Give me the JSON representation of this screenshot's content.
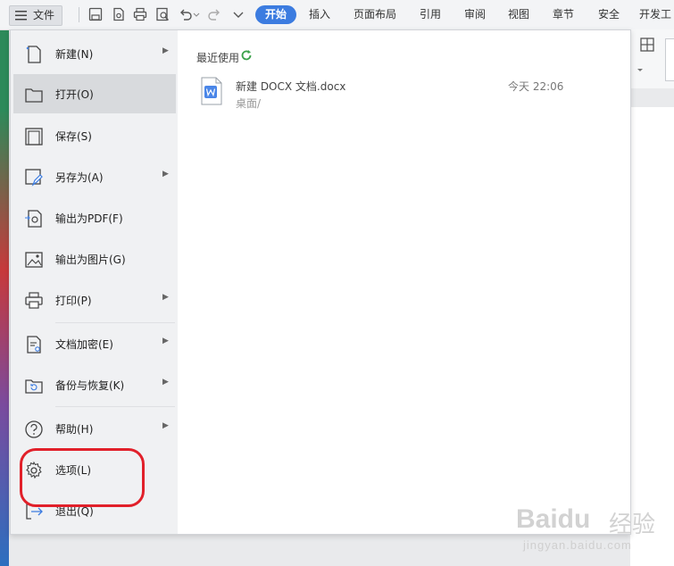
{
  "toolbar": {
    "file_menu_label": "文件",
    "tabs": [
      {
        "label": "开始",
        "active": true
      },
      {
        "label": "插入"
      },
      {
        "label": "页面布局"
      },
      {
        "label": "引用"
      },
      {
        "label": "审阅"
      },
      {
        "label": "视图"
      },
      {
        "label": "章节"
      },
      {
        "label": "安全"
      },
      {
        "label": "开发工"
      }
    ]
  },
  "file_menu": {
    "items": [
      {
        "label": "新建(N)",
        "icon": "new-doc-icon",
        "has_submenu": true
      },
      {
        "label": "打开(O)",
        "icon": "folder-open-icon",
        "has_submenu": false,
        "selected": true
      },
      {
        "label": "保存(S)",
        "icon": "save-icon",
        "has_submenu": false
      },
      {
        "label": "另存为(A)",
        "icon": "save-as-icon",
        "has_submenu": true
      },
      {
        "label": "输出为PDF(F)",
        "icon": "export-pdf-icon",
        "has_submenu": false
      },
      {
        "label": "输出为图片(G)",
        "icon": "export-image-icon",
        "has_submenu": false
      },
      {
        "label": "打印(P)",
        "icon": "print-icon",
        "has_submenu": true
      },
      {
        "label": "文档加密(E)",
        "icon": "encrypt-doc-icon",
        "has_submenu": true
      },
      {
        "label": "备份与恢复(K)",
        "icon": "backup-restore-icon",
        "has_submenu": true
      },
      {
        "label": "帮助(H)",
        "icon": "help-icon",
        "has_submenu": true
      },
      {
        "label": "选项(L)",
        "icon": "gear-icon",
        "has_submenu": false
      },
      {
        "label": "退出(Q)",
        "icon": "exit-icon",
        "has_submenu": false
      }
    ]
  },
  "recent": {
    "title": "最近使用",
    "files": [
      {
        "name": "新建 DOCX 文档.docx",
        "path": "桌面/",
        "time": "今天 22:06"
      }
    ]
  },
  "watermark": {
    "logo": "Baidu",
    "logo_cn": "经验",
    "site": "jingyan.baidu.com"
  },
  "colors": {
    "accent": "#3c7ce0",
    "annotation": "#e1202a",
    "refresh_green": "#3aa14a",
    "word_blue": "#4a86e8"
  }
}
